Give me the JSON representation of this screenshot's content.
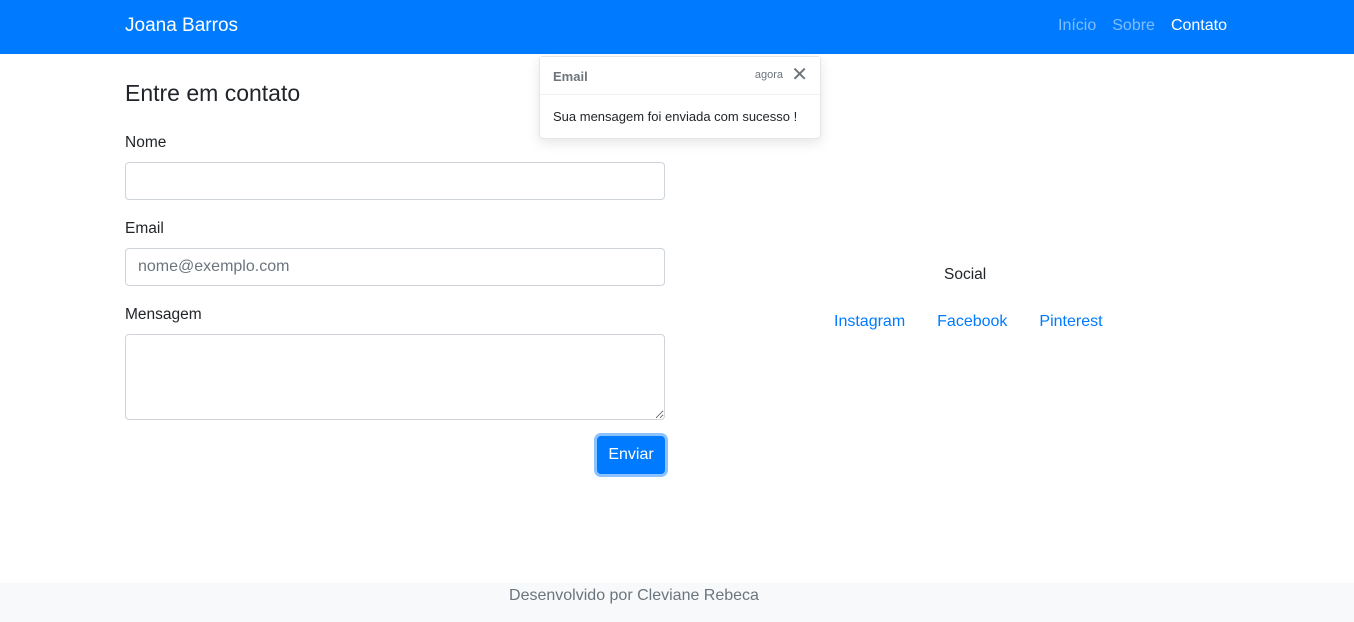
{
  "navbar": {
    "brand": "Joana Barros",
    "links": [
      "Início",
      "Sobre",
      "Contato"
    ],
    "active": "Contato",
    "color": "#007bff"
  },
  "form": {
    "title": "Entre em contato",
    "name_label": "Nome",
    "name_value": "",
    "email_label": "Email",
    "email_placeholder": "nome@exemplo.com",
    "message_label": "Mensagem",
    "message_value": "",
    "submit_label": "Enviar"
  },
  "social": {
    "title": "Social",
    "links": [
      "Instagram",
      "Facebook",
      "Pinterest"
    ]
  },
  "toast": {
    "title": "Email",
    "time": "agora",
    "close_icon": "close-icon",
    "body": "Sua mensagem foi enviada com sucesso !"
  },
  "footer": {
    "text": "Desenvolvido por Cleviane Rebeca"
  }
}
